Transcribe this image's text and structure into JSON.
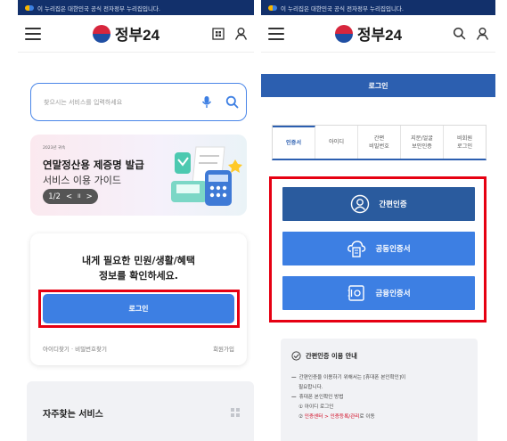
{
  "colors": {
    "gov_banner": "#12306b",
    "primary_blue": "#3d7fe3",
    "dark_blue": "#2a5b9e",
    "highlight_red": "#e60012"
  },
  "gov_banner_text": "이 누리집은 대한민국 공식 전자정부 누리집입니다.",
  "logo_text": "정부24",
  "left": {
    "search_placeholder": "찾으시는 서비스를 입력하세요",
    "promo": {
      "tag": "2023년 귀속",
      "title": "연말정산용 제증명 발급",
      "subtitle": "서비스 이용 가이드",
      "pager": "1/2",
      "pager_prev": "<",
      "pager_pause": "II",
      "pager_next": ">"
    },
    "card": {
      "message_line1": "내게 필요한 민원/생활/혜택",
      "message_line2": "정보를 확인하세요.",
      "login_button": "로그인",
      "links": "아이디찾기 · 비밀번호찾기",
      "signup": "회원가입"
    },
    "frequent_services_title": "자주찾는 서비스"
  },
  "right": {
    "page_title": "로그인",
    "tabs": [
      {
        "label": "인증서",
        "active": true
      },
      {
        "label": "아이디",
        "active": false
      },
      {
        "label": "간편\n비밀번호",
        "active": false
      },
      {
        "label": "지문/얼굴\n보안인증",
        "active": false
      },
      {
        "label": "비회원\n로그인",
        "active": false
      }
    ],
    "methods": [
      {
        "label": "간편인증",
        "icon": "person-circle-icon"
      },
      {
        "label": "공동인증서",
        "icon": "cloud-certificate-icon"
      },
      {
        "label": "금융인증서",
        "icon": "safe-icon"
      }
    ],
    "guide": {
      "title": "간편인증 이용 안내",
      "line1": "간편인증을 이용하기 위해서는 [휴대폰 본인확인]이",
      "line2": "필요합니다.",
      "line3": "휴대폰 본인확인 방법",
      "line4": "① 아이디 로그인",
      "line5_prefix": "② ",
      "line5_red": "인증센터 > 인증등록/관리",
      "line5_suffix": "로 이동"
    }
  }
}
